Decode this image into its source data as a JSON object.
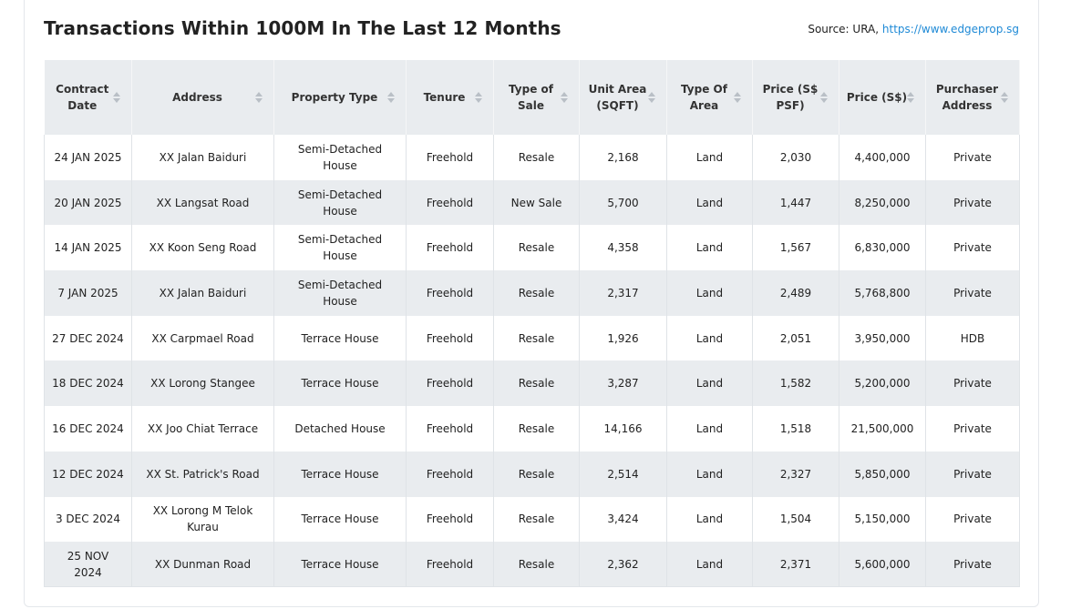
{
  "header": {
    "title": "Transactions Within 1000M In The Last 12 Months",
    "source_prefix": "Source: URA, ",
    "source_link": "https://www.edgeprop.sg"
  },
  "table": {
    "columns": [
      "Contract Date",
      "Address",
      "Property Type",
      "Tenure",
      "Type of Sale",
      "Unit Area (SQFT)",
      "Type Of Area",
      "Price (S$ PSF)",
      "Price (S$)",
      "Purchaser Address"
    ],
    "rows": [
      [
        "24 JAN 2025",
        "XX Jalan Baiduri",
        "Semi-Detached House",
        "Freehold",
        "Resale",
        "2,168",
        "Land",
        "2,030",
        "4,400,000",
        "Private"
      ],
      [
        "20 JAN 2025",
        "XX Langsat Road",
        "Semi-Detached House",
        "Freehold",
        "New Sale",
        "5,700",
        "Land",
        "1,447",
        "8,250,000",
        "Private"
      ],
      [
        "14 JAN 2025",
        "XX Koon Seng Road",
        "Semi-Detached House",
        "Freehold",
        "Resale",
        "4,358",
        "Land",
        "1,567",
        "6,830,000",
        "Private"
      ],
      [
        "7 JAN 2025",
        "XX Jalan Baiduri",
        "Semi-Detached House",
        "Freehold",
        "Resale",
        "2,317",
        "Land",
        "2,489",
        "5,768,800",
        "Private"
      ],
      [
        "27 DEC 2024",
        "XX Carpmael Road",
        "Terrace House",
        "Freehold",
        "Resale",
        "1,926",
        "Land",
        "2,051",
        "3,950,000",
        "HDB"
      ],
      [
        "18 DEC 2024",
        "XX Lorong Stangee",
        "Terrace House",
        "Freehold",
        "Resale",
        "3,287",
        "Land",
        "1,582",
        "5,200,000",
        "Private"
      ],
      [
        "16 DEC 2024",
        "XX Joo Chiat Terrace",
        "Detached House",
        "Freehold",
        "Resale",
        "14,166",
        "Land",
        "1,518",
        "21,500,000",
        "Private"
      ],
      [
        "12 DEC 2024",
        "XX St. Patrick's Road",
        "Terrace House",
        "Freehold",
        "Resale",
        "2,514",
        "Land",
        "2,327",
        "5,850,000",
        "Private"
      ],
      [
        "3 DEC 2024",
        "XX Lorong M Telok Kurau",
        "Terrace House",
        "Freehold",
        "Resale",
        "3,424",
        "Land",
        "1,504",
        "5,150,000",
        "Private"
      ],
      [
        "25 NOV 2024",
        "XX Dunman Road",
        "Terrace House",
        "Freehold",
        "Resale",
        "2,362",
        "Land",
        "2,371",
        "5,600,000",
        "Private"
      ]
    ]
  },
  "colors": {
    "header_bg": "#e9ecef",
    "stripe_bg": "#e9ecef",
    "link": "#1f8ad6"
  }
}
